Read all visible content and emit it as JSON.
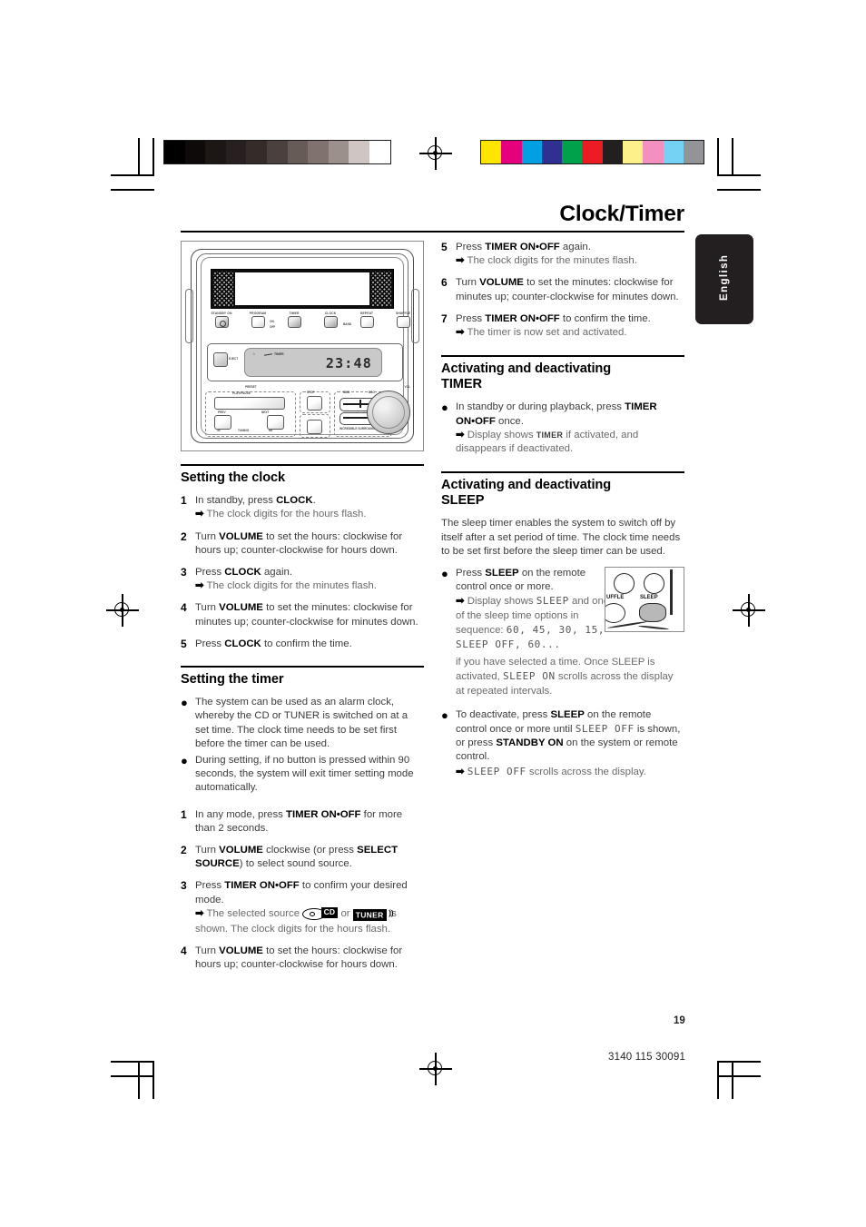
{
  "document": {
    "chapter_title": "Clock/Timer",
    "language_tab": "English",
    "page_number": "19",
    "doc_code": "3140 115 30091"
  },
  "color_bars": {
    "grayscale": [
      "#000000",
      "#0d0a09",
      "#1c1614",
      "#282020",
      "#352b29",
      "#4a403d",
      "#665b57",
      "#80736f",
      "#9c908c",
      "#cfc6c3",
      "#ffffff"
    ],
    "color": [
      "#ffe500",
      "#e5007e",
      "#00a0e3",
      "#2e3192",
      "#00a14b",
      "#ed1c24",
      "#231f20",
      "#fdf08a",
      "#f490c0",
      "#74d3f5",
      "#929497"
    ]
  },
  "illustration": {
    "name": "audio-system-front-panel",
    "buttons": [
      {
        "label": "STANDBY ON"
      },
      {
        "label": "PROGRAM"
      },
      {
        "label": "TIMER"
      },
      {
        "label": "CLOCK"
      },
      {
        "label": "REPEAT"
      },
      {
        "label": "SHUFFLE"
      }
    ],
    "side_tags": [
      "ON",
      "OFF",
      "BAND"
    ],
    "lcd_time": "23:48",
    "lcd_timer_label": "TIMER",
    "eject_label": "EJECT",
    "lower_labels": {
      "preset": "PRESET",
      "play_pause": "PLAY/PAUSE",
      "stop": "STOP",
      "prev": "PREV",
      "next": "NEXT",
      "tuning": "TUNING",
      "rew": "44",
      "ffw": "bb",
      "dbb": "DBB",
      "dsc": "DSC",
      "surround": "INCREDIBLE SURROUND",
      "vol": "VOL"
    }
  },
  "left_column": {
    "section_clock": {
      "heading": "Setting the clock",
      "steps": [
        {
          "num": "1",
          "text_html": "In standby, press <b>CLOCK</b>.",
          "sub": "The clock digits for the hours flash."
        },
        {
          "num": "2",
          "text_html": "Turn <b>VOLUME</b> to set the hours: clockwise for hours up; counter-clockwise for hours down."
        },
        {
          "num": "3",
          "text_html": "Press <b>CLOCK</b> again.",
          "sub": "The clock digits for the minutes flash."
        },
        {
          "num": "4",
          "text_html": "Turn <b>VOLUME</b> to set the minutes: clockwise for minutes up; counter-clockwise for minutes down."
        },
        {
          "num": "5",
          "text_html": "Press <b>CLOCK</b> to confirm the time."
        }
      ]
    },
    "section_timer": {
      "heading": "Setting the timer",
      "bullets": [
        "The system can be used as an alarm clock, whereby the CD or TUNER is switched on at a set time. The clock time needs to be set first before the timer can be used.",
        "During setting, if no button is pressed within 90 seconds, the system will exit timer setting mode automatically."
      ],
      "steps": [
        {
          "num": "1",
          "text_html": "In any mode, press <b>TIMER ON•OFF</b> for more than 2 seconds."
        },
        {
          "num": "2",
          "text_html": "Turn <b>VOLUME</b> clockwise (or press <b>SELECT SOURCE</b>) to select sound source."
        },
        {
          "num": "3",
          "text_html": "Press <b>TIMER ON•OFF</b> to confirm your desired mode."
        },
        {
          "num": "4",
          "text_html": "Turn <b>VOLUME</b> to set the hours: clockwise for hours up; counter-clockwise for hours down."
        }
      ],
      "step3_sub_pre": "The selected source",
      "step3_sub_or": "or",
      "step3_sub_post": "is shown. The clock digits for the hours flash.",
      "badge_cd": "CD",
      "badge_tuner": "TUNER"
    }
  },
  "right_column": {
    "steps_continued": [
      {
        "num": "5",
        "text_html": "Press <b>TIMER ON•OFF</b> again.",
        "sub": "The clock digits for the minutes flash."
      },
      {
        "num": "6",
        "text_html": "Turn <b>VOLUME</b> to set the minutes: clockwise for minutes up; counter-clockwise for minutes down."
      },
      {
        "num": "7",
        "text_html": "Press <b>TIMER ON•OFF</b> to confirm the time.",
        "sub": "The timer is now set and activated."
      }
    ],
    "section_timer_act": {
      "heading_line1": "Activating and deactivating",
      "heading_line2": "TIMER",
      "bullet_pre": "In standby or during playback, press",
      "bullet_bold": "TIMER ON•OFF",
      "bullet_post": "once.",
      "sub_pre": "Display shows",
      "sub_caps": "TIMER",
      "sub_post": "if activated, and disappears if deactivated."
    },
    "section_sleep": {
      "heading_line1": "Activating and deactivating",
      "heading_line2": "SLEEP",
      "intro": "The sleep timer enables the system to switch off by itself after a set period of time. The clock time needs to be set first before the sleep timer can be used.",
      "bullet1_pre": "Press",
      "bullet1_bold": "SLEEP",
      "bullet1_post": "on the remote control once or more.",
      "bullet1_sub_pre": "Display shows",
      "bullet1_sleep": "SLEEP",
      "bullet1_sub_mid": "and one of the sleep time options in sequence:",
      "bullet1_options": "60, 45, 30, 15,",
      "bullet1_options2": "SLEEP OFF, 60...",
      "bullet1_sub_tail": "if you have selected a time. Once SLEEP is activated,",
      "bullet1_scroll": "SLEEP ON",
      "bullet1_sub_end": "scrolls across the display at repeated intervals.",
      "bullet2_pre": "To deactivate, press",
      "bullet2_bold": "SLEEP",
      "bullet2_mid": "on the remote control once or more until",
      "bullet2_lcd": "SLEEP OFF",
      "bullet2_mid2": "is shown, or press",
      "bullet2_bold2": "STANDBY ON",
      "bullet2_post": "on the system or remote control.",
      "bullet2_sub_lcd": "SLEEP OFF",
      "bullet2_sub_post": "scrolls across the display.",
      "remote_labels": {
        "shuffle": "UFFLE",
        "sleep": "SLEEP"
      }
    }
  }
}
